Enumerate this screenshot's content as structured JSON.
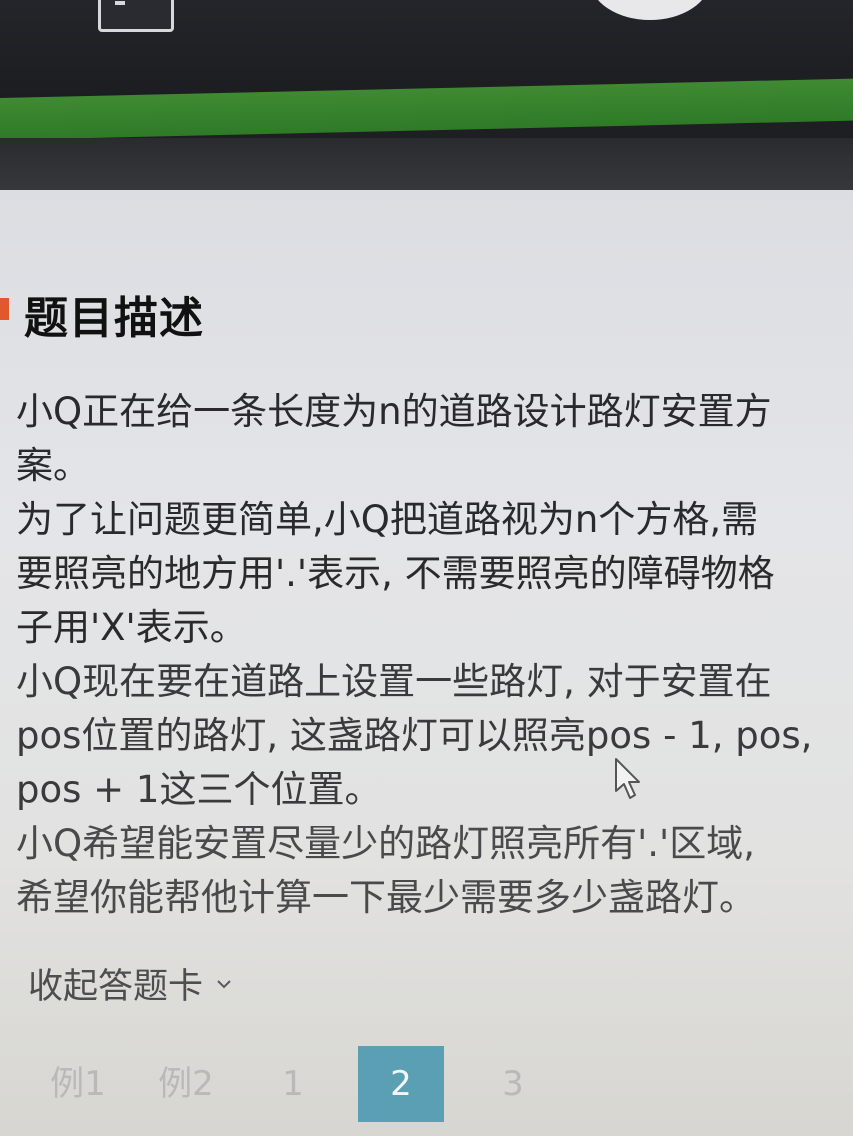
{
  "section": {
    "title": "题目描述"
  },
  "description": {
    "lines": [
      "小Q正在给一条长度为n的道路设计路灯安置方",
      "案。",
      "为了让问题更简单,小Q把道路视为n个方格,需",
      "要照亮的地方用'.'表示, 不需要照亮的障碍物格",
      "子用'X'表示。",
      "小Q现在要在道路上设置一些路灯, 对于安置在",
      "pos位置的路灯, 这盏路灯可以照亮pos - 1, pos,",
      "pos + 1这三个位置。",
      "小Q希望能安置尽量少的路灯照亮所有'.'区域,",
      "希望你能帮他计算一下最少需要多少盏路灯。"
    ]
  },
  "answer_card": {
    "toggle_label": "收起答题卡",
    "tabs": [
      {
        "label": "例1"
      },
      {
        "label": "例2"
      },
      {
        "label": "1"
      },
      {
        "label": "2",
        "active": true
      },
      {
        "label": "3"
      }
    ]
  },
  "colors": {
    "accent_marker": "#e0582b",
    "active_tab": "#5a9fb3",
    "header_green": "#3f8a32"
  },
  "icons": {
    "top_left": "window-icon",
    "cursor": "mouse-pointer-icon",
    "toggle": "chevron-down-icon"
  }
}
